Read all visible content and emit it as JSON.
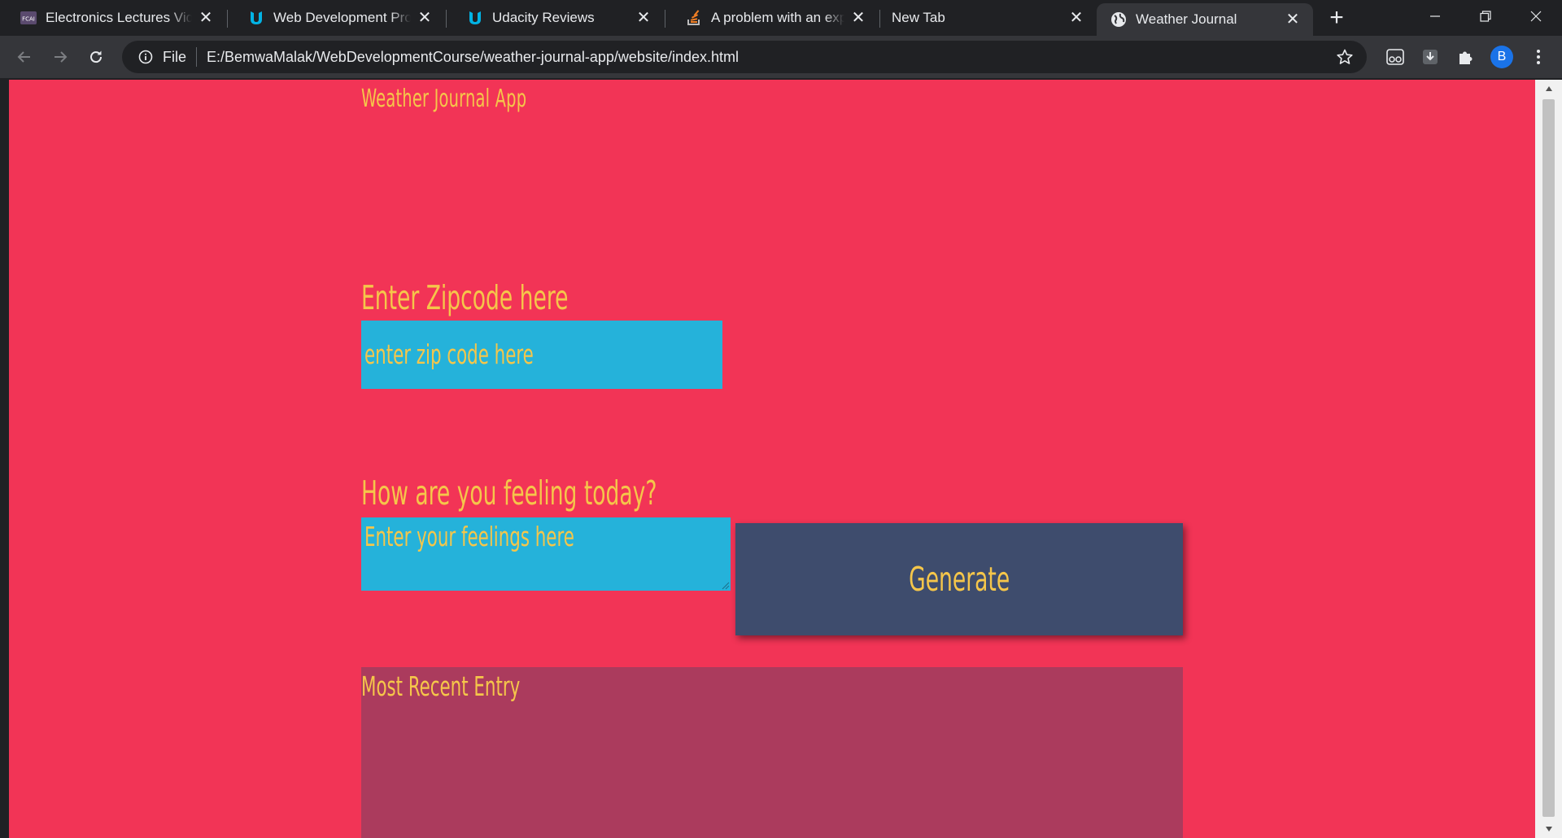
{
  "browser": {
    "tabs": [
      {
        "title": "Electronics Lectures Vide",
        "icon": "fcai-icon",
        "active": false
      },
      {
        "title": "Web Development Profe",
        "icon": "udacity-icon",
        "active": false
      },
      {
        "title": "Udacity Reviews",
        "icon": "udacity-icon",
        "active": false
      },
      {
        "title": "A problem with an expre",
        "icon": "stackoverflow-icon",
        "active": false
      },
      {
        "title": "New Tab",
        "icon": "",
        "active": false
      },
      {
        "title": "Weather Journal",
        "icon": "globe-icon",
        "active": true
      }
    ],
    "scheme_label": "File",
    "url": "E:/BemwaMalak/WebDevelopmentCourse/weather-journal-app/website/index.html",
    "profile_initial": "B",
    "colors": {
      "frame": "#202124",
      "toolbar": "#35363a",
      "accent": "#1a73e8"
    }
  },
  "page": {
    "app_title": "Weather Journal App",
    "zip_label": "Enter Zipcode here",
    "zip_placeholder": "enter zip code here",
    "feelings_label": "How are you feeling today?",
    "feelings_placeholder": "Enter your feelings here",
    "generate_label": "Generate",
    "entry_title": "Most Recent Entry",
    "colors": {
      "background": "#f23456",
      "text": "#f5c64a",
      "input": "#25b2da",
      "button": "#3e4c6d",
      "entry_panel": "#ab3b5d"
    }
  }
}
